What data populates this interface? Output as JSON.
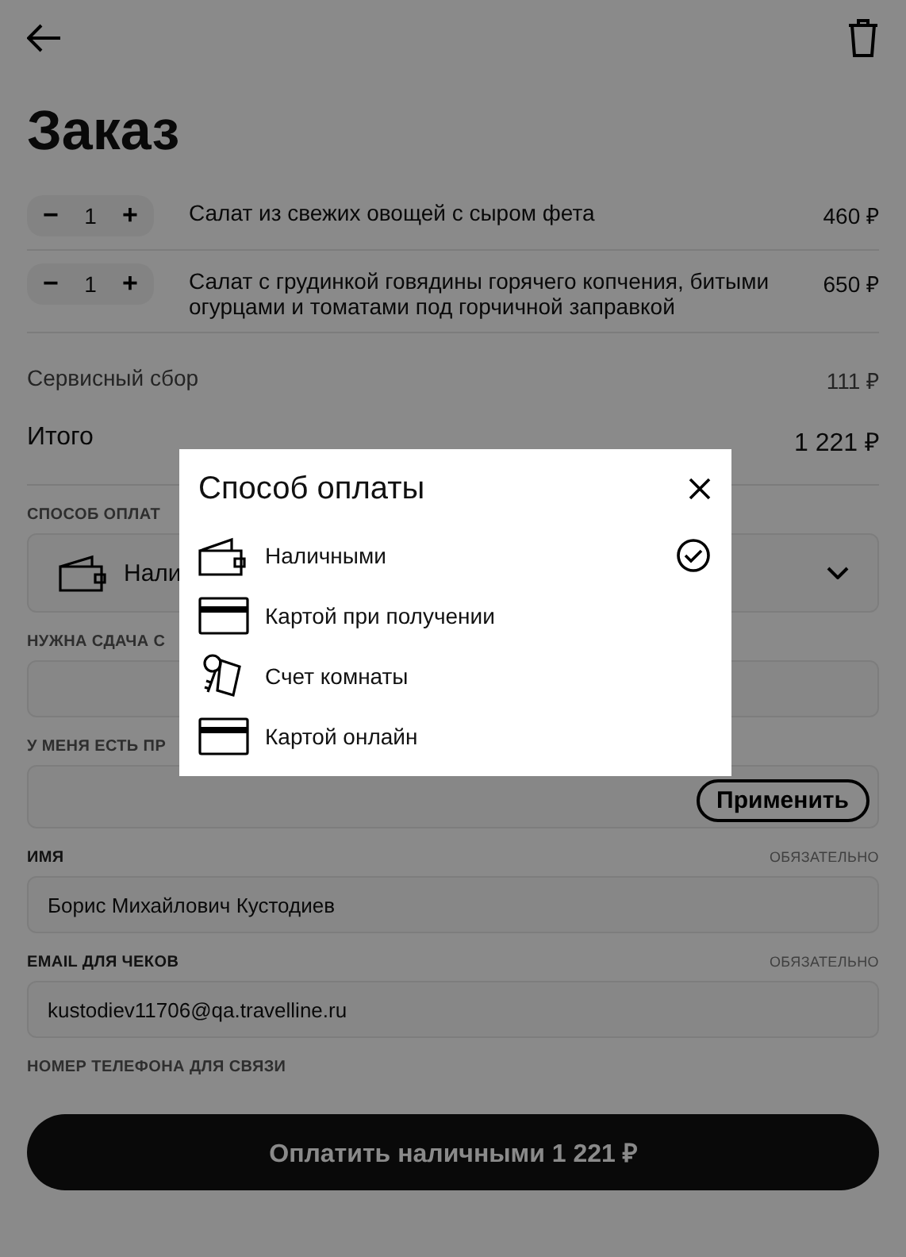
{
  "title": "Заказ",
  "items": [
    {
      "minus": "−",
      "qty": "1",
      "plus": "+",
      "name": "Салат из свежих овощей с сыром фета",
      "price": "460 ₽"
    },
    {
      "minus": "−",
      "qty": "1",
      "plus": "+",
      "name": "Салат с грудинкой говядины горячего копчения, битыми огурцами и томатами под горчичной заправкой",
      "price": "650 ₽"
    }
  ],
  "service_fee": {
    "label": "Сервисный сбор",
    "value": "111 ₽"
  },
  "total": {
    "label": "Итого",
    "value": "1 221 ₽"
  },
  "payment": {
    "label": "СПОСОБ ОПЛАТ",
    "value": "Нали"
  },
  "change": {
    "label": "НУЖНА СДАЧА С"
  },
  "promo": {
    "label": "У МЕНЯ ЕСТЬ ПР",
    "button": "Применить"
  },
  "name": {
    "label": "ИМЯ",
    "required": "ОБЯЗАТЕЛЬНО",
    "value": "Борис Михайлович Кустодиев"
  },
  "email": {
    "label": "EMAIL ДЛЯ ЧЕКОВ",
    "required": "ОБЯЗАТЕЛЬНО",
    "value": "kustodiev11706@qa.travelline.ru"
  },
  "phone": {
    "label": "НОМЕР ТЕЛЕФОНА ДЛЯ СВЯЗИ"
  },
  "pay_button": "Оплатить наличными 1 221 ₽",
  "modal": {
    "title": "Способ оплаты",
    "options": [
      {
        "kind": "wallet",
        "label": "Наличными",
        "selected": true
      },
      {
        "kind": "card",
        "label": "Картой при получении",
        "selected": false
      },
      {
        "kind": "key",
        "label": "Счет комнаты",
        "selected": false
      },
      {
        "kind": "card",
        "label": "Картой онлайн",
        "selected": false
      }
    ]
  }
}
